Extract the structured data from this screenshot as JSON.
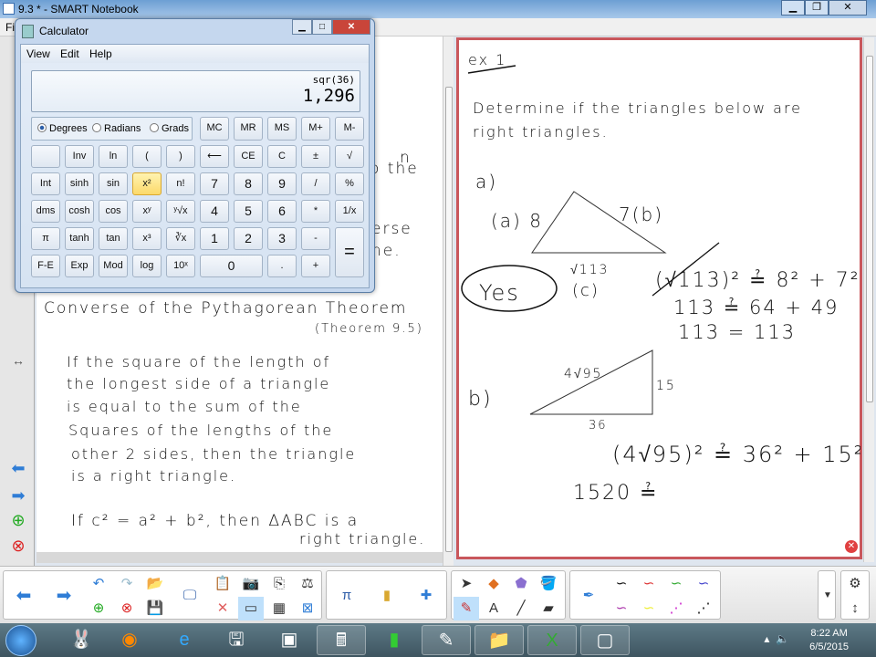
{
  "window": {
    "title": "9.3 * - SMART Notebook",
    "menu_first": "Fi"
  },
  "calculator": {
    "title": "Calculator",
    "menu": [
      "View",
      "Edit",
      "Help"
    ],
    "expression": "sqr(36)",
    "value": "1,296",
    "angle_modes": [
      "Degrees",
      "Radians",
      "Grads"
    ],
    "selected_mode": "Degrees",
    "memory": [
      "MC",
      "MR",
      "MS",
      "M+",
      "M-"
    ],
    "rows": [
      [
        "",
        "Inv",
        "ln",
        "(",
        ")",
        "⟵",
        "CE",
        "C",
        "±",
        "√"
      ],
      [
        "Int",
        "sinh",
        "sin",
        "x²",
        "n!",
        "7",
        "8",
        "9",
        "/",
        "%"
      ],
      [
        "dms",
        "cosh",
        "cos",
        "xʸ",
        "ʸ√x",
        "4",
        "5",
        "6",
        "*",
        "1/x"
      ],
      [
        "π",
        "tanh",
        "tan",
        "x³",
        "∛x",
        "1",
        "2",
        "3",
        "-"
      ],
      [
        "F-E",
        "Exp",
        "Mod",
        "log",
        "10ˣ",
        "0",
        ".",
        "+"
      ]
    ],
    "equals": "=",
    "highlighted": "x²"
  },
  "left_page": {
    "partial": [
      "n",
      "o the",
      "erse",
      "ne."
    ],
    "heading": "Converse of the Pythagorean Theorem",
    "subheading": "(Theorem 9.5)",
    "body": [
      "If the square of the length of",
      "the longest side of a triangle",
      "is equal to the sum of the",
      "Squares of the lengths of the",
      "other 2 sides, then the triangle",
      "is a right triangle."
    ],
    "formula_1": "If c² = a² + b², then ΔABC is a",
    "formula_2": "right triangle."
  },
  "right_page": {
    "label": "ex 1",
    "prompt_1": "Determine if the triangles below are",
    "prompt_2": "right triangles.",
    "part_a": {
      "label": "a)",
      "side_a": "(a) 8",
      "side_b": "7(b)",
      "side_c": "√113",
      "side_c_label": "(c)",
      "answer": "Yes",
      "work": [
        "(√113)² ≟ 8² + 7²",
        "113 ≟ 64 + 49",
        "113 = 113"
      ]
    },
    "part_b": {
      "label": "b)",
      "hyp": "4√95",
      "leg1": "15",
      "leg2": "36",
      "work": [
        "(4√95)² ≟ 36² + 15²",
        "1520 ≟"
      ]
    }
  },
  "taskbar": {
    "time": "8:22 AM",
    "date": "6/5/2015"
  }
}
